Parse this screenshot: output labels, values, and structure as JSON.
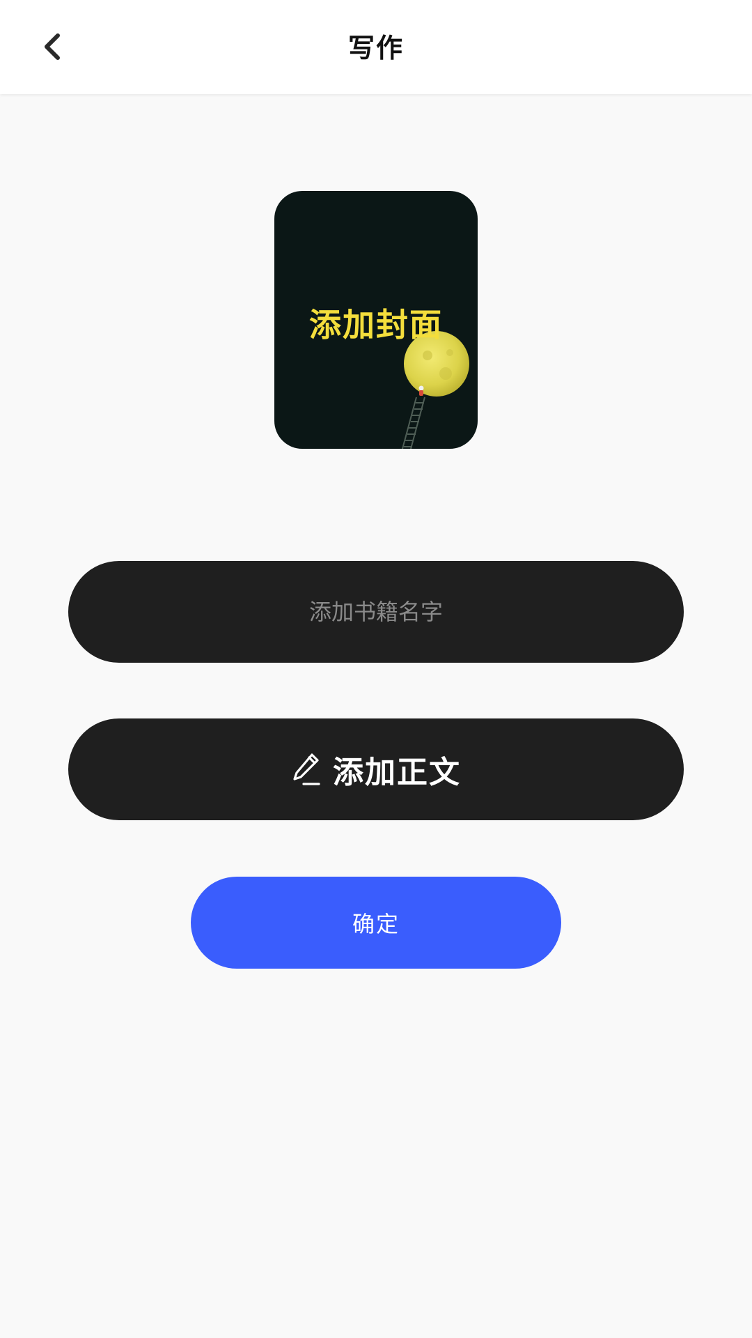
{
  "header": {
    "title": "写作",
    "back_icon": "chevron-left-icon"
  },
  "cover": {
    "label": "添加封面",
    "label_color": "#f4de3c",
    "background_color": "#0b1716"
  },
  "form": {
    "name_placeholder": "添加书籍名字",
    "name_value": "",
    "content_label": "添加正文",
    "content_icon": "pencil-icon",
    "confirm_label": "确定"
  },
  "colors": {
    "accent": "#3a5dfd",
    "pill_background": "#1f1f1f",
    "page_background": "#f9f9f9"
  }
}
